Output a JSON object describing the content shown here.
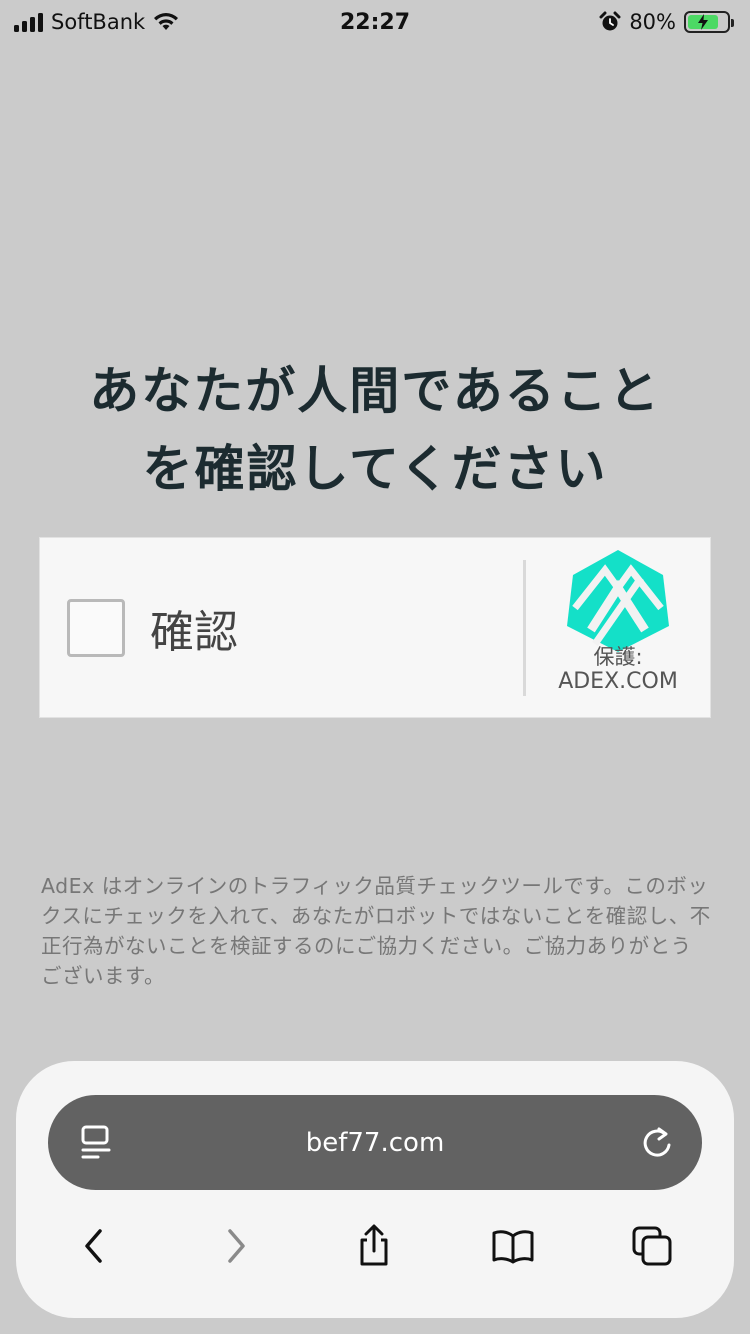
{
  "status_bar": {
    "carrier": "SoftBank",
    "time": "22:27",
    "battery_percent": "80%",
    "battery_level": 0.8,
    "icons": [
      "signal-icon",
      "wifi-icon",
      "alarm-icon",
      "battery-charging-icon"
    ]
  },
  "heading": {
    "line1": "あなたが人間であること",
    "line2": "を確認してください"
  },
  "captcha": {
    "checkbox_label": "確認",
    "checked": false,
    "protected_by": "保護:",
    "brand": "ADEX.COM",
    "logo_color": "#14e0c8"
  },
  "description": "AdEx はオンラインのトラフィック品質チェックツールです。このボックスにチェックを入れて、あなたがロボットではないことを確認し、不正行為がないことを検証するのにご協力ください。ご協力ありがとうございます。",
  "browser": {
    "url": "bef77.com",
    "toolbar_icons": [
      "back-icon",
      "forward-icon",
      "share-icon",
      "bookmarks-icon",
      "tabs-icon"
    ]
  },
  "colors": {
    "background": "#cbcbcb",
    "heading": "#1c2b30",
    "url_bar": "#626262",
    "battery_fill": "#4cd964"
  }
}
